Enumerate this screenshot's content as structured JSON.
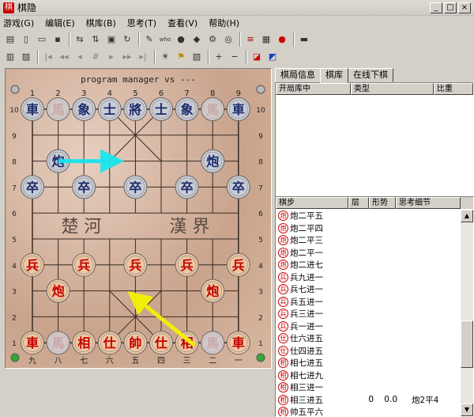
{
  "window": {
    "title": "棋隐",
    "icon": "棋",
    "min": "_",
    "max": "□",
    "close": "×"
  },
  "menu": [
    "游戏(G)",
    "编辑(E)",
    "棋库(B)",
    "思考(T)",
    "查看(V)",
    "帮助(H)"
  ],
  "board": {
    "caption": "program manager vs ---",
    "top_files": [
      "1",
      "2",
      "3",
      "4",
      "5",
      "6",
      "7",
      "8",
      "9"
    ],
    "bottom_files": [
      "九",
      "八",
      "七",
      "六",
      "五",
      "四",
      "三",
      "二",
      "一"
    ],
    "ranks": [
      "10",
      "9",
      "8",
      "7",
      "6",
      "5",
      "4",
      "3",
      "2",
      "1"
    ],
    "river_left": "楚 河",
    "river_right": "漢 界",
    "black_color": "#1a2a6a",
    "red_color": "#c40000",
    "pieces": [
      {
        "c": 0,
        "r": 0,
        "t": "車",
        "s": "b"
      },
      {
        "c": 1,
        "r": 0,
        "t": "馬",
        "s": "b",
        "faded": true
      },
      {
        "c": 2,
        "r": 0,
        "t": "象",
        "s": "b"
      },
      {
        "c": 3,
        "r": 0,
        "t": "士",
        "s": "b"
      },
      {
        "c": 4,
        "r": 0,
        "t": "將",
        "s": "b"
      },
      {
        "c": 5,
        "r": 0,
        "t": "士",
        "s": "b"
      },
      {
        "c": 6,
        "r": 0,
        "t": "象",
        "s": "b"
      },
      {
        "c": 7,
        "r": 0,
        "t": "馬",
        "s": "b",
        "faded": true
      },
      {
        "c": 8,
        "r": 0,
        "t": "車",
        "s": "b"
      },
      {
        "c": 1,
        "r": 2,
        "t": "炮",
        "s": "b"
      },
      {
        "c": 7,
        "r": 2,
        "t": "炮",
        "s": "b"
      },
      {
        "c": 0,
        "r": 3,
        "t": "卒",
        "s": "b"
      },
      {
        "c": 2,
        "r": 3,
        "t": "卒",
        "s": "b"
      },
      {
        "c": 4,
        "r": 3,
        "t": "卒",
        "s": "b"
      },
      {
        "c": 6,
        "r": 3,
        "t": "卒",
        "s": "b"
      },
      {
        "c": 8,
        "r": 3,
        "t": "卒",
        "s": "b"
      },
      {
        "c": 0,
        "r": 6,
        "t": "兵",
        "s": "r"
      },
      {
        "c": 2,
        "r": 6,
        "t": "兵",
        "s": "r"
      },
      {
        "c": 4,
        "r": 6,
        "t": "兵",
        "s": "r"
      },
      {
        "c": 6,
        "r": 6,
        "t": "兵",
        "s": "r"
      },
      {
        "c": 8,
        "r": 6,
        "t": "兵",
        "s": "r"
      },
      {
        "c": 1,
        "r": 7,
        "t": "炮",
        "s": "r"
      },
      {
        "c": 7,
        "r": 7,
        "t": "炮",
        "s": "r"
      },
      {
        "c": 0,
        "r": 9,
        "t": "車",
        "s": "r"
      },
      {
        "c": 1,
        "r": 9,
        "t": "馬",
        "s": "r",
        "faded": true
      },
      {
        "c": 2,
        "r": 9,
        "t": "相",
        "s": "r"
      },
      {
        "c": 3,
        "r": 9,
        "t": "仕",
        "s": "r"
      },
      {
        "c": 4,
        "r": 9,
        "t": "帥",
        "s": "r"
      },
      {
        "c": 5,
        "r": 9,
        "t": "仕",
        "s": "r"
      },
      {
        "c": 6,
        "r": 9,
        "t": "相",
        "s": "r"
      },
      {
        "c": 7,
        "r": 9,
        "t": "馬",
        "s": "r",
        "faded": true
      },
      {
        "c": 8,
        "r": 9,
        "t": "車",
        "s": "r"
      }
    ],
    "arrows": [
      {
        "from": [
          1,
          2
        ],
        "to": [
          3.1,
          2
        ],
        "color": "#19e6ee"
      },
      {
        "from": [
          6.3,
          9.1
        ],
        "to": [
          4.05,
          7.3
        ],
        "color": "#f6f200"
      }
    ]
  },
  "tabs": [
    "棋局信息",
    "棋库",
    "在线下棋"
  ],
  "opening_headers": [
    "开局库中",
    "类型",
    "比重"
  ],
  "move_headers": [
    "棋步",
    "层",
    "形势",
    "思考细节"
  ],
  "moves": [
    {
      "icon": "炮",
      "text": "炮二平五",
      "depth": "",
      "score": "",
      "detail": ""
    },
    {
      "icon": "炮",
      "text": "炮二平四",
      "depth": "",
      "score": "",
      "detail": ""
    },
    {
      "icon": "炮",
      "text": "炮二平三",
      "depth": "",
      "score": "",
      "detail": ""
    },
    {
      "icon": "炮",
      "text": "炮二平一",
      "depth": "",
      "score": "",
      "detail": ""
    },
    {
      "icon": "炮",
      "text": "炮二进七",
      "depth": "",
      "score": "",
      "detail": ""
    },
    {
      "icon": "兵",
      "text": "兵九进一",
      "depth": "",
      "score": "",
      "detail": ""
    },
    {
      "icon": "兵",
      "text": "兵七进一",
      "depth": "",
      "score": "",
      "detail": ""
    },
    {
      "icon": "兵",
      "text": "兵五进一",
      "depth": "",
      "score": "",
      "detail": ""
    },
    {
      "icon": "兵",
      "text": "兵三进一",
      "depth": "",
      "score": "",
      "detail": ""
    },
    {
      "icon": "兵",
      "text": "兵一进一",
      "depth": "",
      "score": "",
      "detail": ""
    },
    {
      "icon": "仕",
      "text": "仕六进五",
      "depth": "",
      "score": "",
      "detail": ""
    },
    {
      "icon": "仕",
      "text": "仕四进五",
      "depth": "",
      "score": "",
      "detail": ""
    },
    {
      "icon": "相",
      "text": "相七进五",
      "depth": "",
      "score": "",
      "detail": ""
    },
    {
      "icon": "相",
      "text": "相七进九",
      "depth": "",
      "score": "",
      "detail": ""
    },
    {
      "icon": "相",
      "text": "相三进一",
      "depth": "",
      "score": "",
      "detail": ""
    },
    {
      "icon": "相",
      "text": "相三进五",
      "depth": "0",
      "score": "0.0",
      "detail": "炮2平4"
    },
    {
      "icon": "相",
      "text": "帅五平六",
      "depth": "",
      "score": "",
      "detail": ""
    }
  ]
}
